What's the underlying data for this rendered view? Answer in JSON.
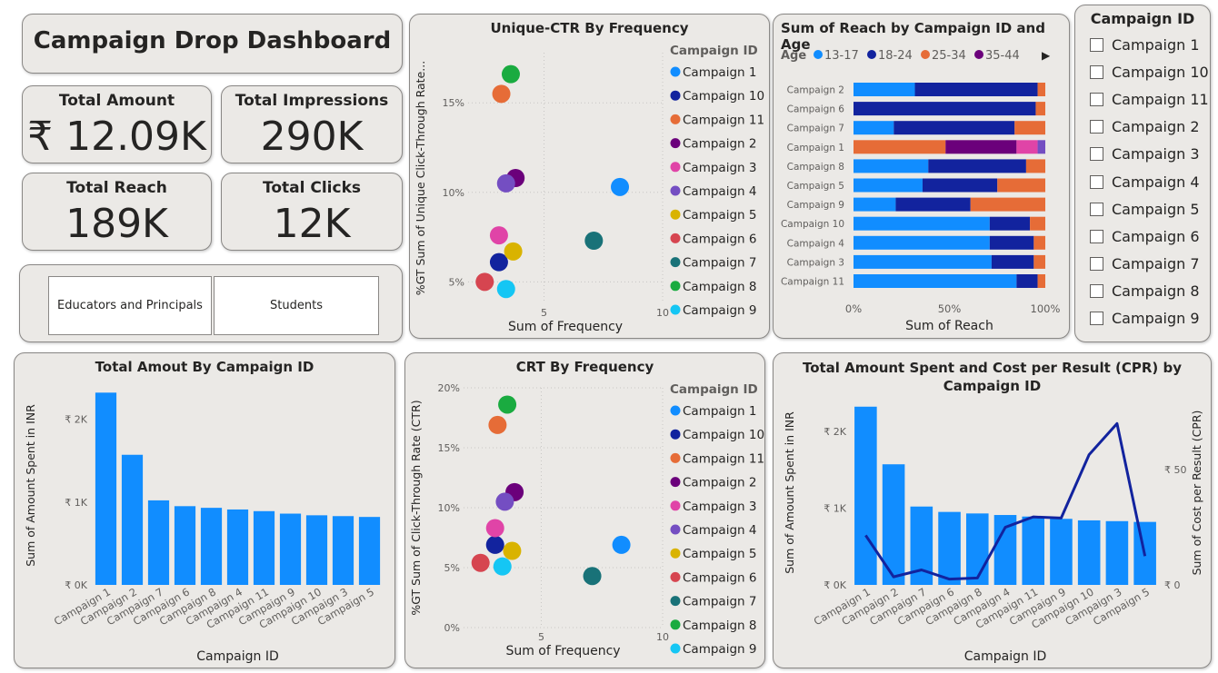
{
  "dashboard_title": "Campaign Drop Dashboard",
  "kpis": [
    {
      "label": "Total Amount",
      "value": "₹ 12.09K"
    },
    {
      "label": "Total Impressions",
      "value": "290K"
    },
    {
      "label": "Total Reach",
      "value": "189K"
    },
    {
      "label": "Total Clicks",
      "value": "12K"
    }
  ],
  "audience_slicer": {
    "options": [
      "Educators and Principals",
      "Students"
    ]
  },
  "campaign_slicer": {
    "title": "Campaign ID",
    "options": [
      "Campaign 1",
      "Campaign 10",
      "Campaign 11",
      "Campaign 2",
      "Campaign 3",
      "Campaign 4",
      "Campaign 5",
      "Campaign 6",
      "Campaign 7",
      "Campaign 8",
      "Campaign 9"
    ]
  },
  "campaign_colors": {
    "Campaign 1": "#118dff",
    "Campaign 10": "#12239e",
    "Campaign 11": "#e66c37",
    "Campaign 2": "#6b007b",
    "Campaign 3": "#e044a7",
    "Campaign 4": "#744ec2",
    "Campaign 5": "#d9b300",
    "Campaign 6": "#d64550",
    "Campaign 7": "#197278",
    "Campaign 8": "#1aab40",
    "Campaign 9": "#15c6f4"
  },
  "chart_data": [
    {
      "id": "unique_ctr",
      "type": "scatter",
      "title": "Unique-CTR By Frequency",
      "xlabel": "Sum of Frequency",
      "ylabel": "%GT Sum of Unique Click-Through Rate...",
      "xlim": [
        1.8,
        10
      ],
      "ylim": [
        3.8,
        17.8
      ],
      "xticks": [
        {
          "v": 5,
          "label": "5"
        },
        {
          "v": 10,
          "label": "10"
        }
      ],
      "yticks": [
        {
          "v": 5,
          "label": "5%"
        },
        {
          "v": 10,
          "label": "10%"
        },
        {
          "v": 15,
          "label": "15%"
        }
      ],
      "legend_title": "Campaign ID",
      "points": [
        {
          "name": "Campaign 1",
          "x": 8.2,
          "y": 10.3
        },
        {
          "name": "Campaign 10",
          "x": 3.1,
          "y": 6.1
        },
        {
          "name": "Campaign 11",
          "x": 3.2,
          "y": 15.5
        },
        {
          "name": "Campaign 2",
          "x": 3.8,
          "y": 10.8
        },
        {
          "name": "Campaign 3",
          "x": 3.1,
          "y": 7.6
        },
        {
          "name": "Campaign 4",
          "x": 3.4,
          "y": 10.5
        },
        {
          "name": "Campaign 5",
          "x": 3.7,
          "y": 6.7
        },
        {
          "name": "Campaign 6",
          "x": 2.5,
          "y": 5.0
        },
        {
          "name": "Campaign 7",
          "x": 7.1,
          "y": 7.3
        },
        {
          "name": "Campaign 8",
          "x": 3.6,
          "y": 16.6
        },
        {
          "name": "Campaign 9",
          "x": 3.4,
          "y": 4.6
        }
      ]
    },
    {
      "id": "reach_age",
      "type": "bar",
      "orientation": "horizontal-100%-stacked",
      "title": "Sum of Reach by Campaign ID and Age",
      "xlabel": "Sum of Reach",
      "legend_title": "Age",
      "legend_more": "▶",
      "xticks": [
        "0%",
        "50%",
        "100%"
      ],
      "categories": [
        "Campaign 2",
        "Campaign 6",
        "Campaign 7",
        "Campaign 1",
        "Campaign 8",
        "Campaign 5",
        "Campaign 9",
        "Campaign 10",
        "Campaign 4",
        "Campaign 3",
        "Campaign 11"
      ],
      "series": [
        {
          "name": "13-17",
          "color": "#118dff",
          "values": [
            32,
            0,
            21,
            0,
            39,
            36,
            22,
            71,
            71,
            72,
            85
          ]
        },
        {
          "name": "18-24",
          "color": "#12239e",
          "values": [
            64,
            95,
            63,
            0,
            51,
            39,
            39,
            21,
            23,
            22,
            11
          ]
        },
        {
          "name": "25-34",
          "color": "#e66c37",
          "values": [
            4,
            5,
            16,
            48,
            10,
            25,
            39,
            8,
            6,
            6,
            4
          ]
        },
        {
          "name": "35-44",
          "color": "#6b007b",
          "values": [
            0,
            0,
            0,
            37,
            0,
            0,
            0,
            0,
            0,
            0,
            0
          ]
        },
        {
          "name": "",
          "color": "#e044a7",
          "values": [
            0,
            0,
            0,
            11,
            0,
            0,
            0,
            0,
            0,
            0,
            0
          ]
        },
        {
          "name": "",
          "color": "#744ec2",
          "values": [
            0,
            0,
            0,
            4,
            0,
            0,
            0,
            0,
            0,
            0,
            0
          ]
        }
      ]
    },
    {
      "id": "amount_by_campaign",
      "type": "bar",
      "title": "Total Amout By Campaign ID",
      "xlabel": "Campaign ID",
      "ylabel": "Sum of Amount Spent in INR",
      "ylim": [
        0,
        2400
      ],
      "yticks": [
        {
          "v": 0,
          "label": "₹ 0K"
        },
        {
          "v": 1000,
          "label": "₹ 1K"
        },
        {
          "v": 2000,
          "label": "₹ 2K"
        }
      ],
      "categories": [
        "Campaign 1",
        "Campaign 2",
        "Campaign 7",
        "Campaign 6",
        "Campaign 8",
        "Campaign 4",
        "Campaign 11",
        "Campaign 9",
        "Campaign 10",
        "Campaign 3",
        "Campaign 5"
      ],
      "values": [
        2320,
        1570,
        1020,
        950,
        930,
        910,
        890,
        860,
        840,
        830,
        820
      ]
    },
    {
      "id": "crt_frequency",
      "type": "scatter",
      "title": "CRT By Frequency",
      "xlabel": "Sum of Frequency",
      "ylabel": "%GT Sum of Click-Through Rate (CTR)",
      "xlim": [
        1.8,
        10
      ],
      "ylim": [
        0,
        20
      ],
      "xticks": [
        {
          "v": 5,
          "label": "5"
        },
        {
          "v": 10,
          "label": "10"
        }
      ],
      "yticks": [
        {
          "v": 0,
          "label": "0%"
        },
        {
          "v": 5,
          "label": "5%"
        },
        {
          "v": 10,
          "label": "10%"
        },
        {
          "v": 15,
          "label": "15%"
        },
        {
          "v": 20,
          "label": "20%"
        }
      ],
      "legend_title": "Campaign ID",
      "points": [
        {
          "name": "Campaign 1",
          "x": 8.3,
          "y": 6.9
        },
        {
          "name": "Campaign 10",
          "x": 3.1,
          "y": 6.9
        },
        {
          "name": "Campaign 11",
          "x": 3.2,
          "y": 16.9
        },
        {
          "name": "Campaign 2",
          "x": 3.9,
          "y": 11.3
        },
        {
          "name": "Campaign 3",
          "x": 3.1,
          "y": 8.3
        },
        {
          "name": "Campaign 4",
          "x": 3.5,
          "y": 10.5
        },
        {
          "name": "Campaign 5",
          "x": 3.8,
          "y": 6.4
        },
        {
          "name": "Campaign 6",
          "x": 2.5,
          "y": 5.4
        },
        {
          "name": "Campaign 7",
          "x": 7.1,
          "y": 4.3
        },
        {
          "name": "Campaign 8",
          "x": 3.6,
          "y": 18.6
        },
        {
          "name": "Campaign 9",
          "x": 3.4,
          "y": 5.1
        }
      ]
    },
    {
      "id": "amount_cpr",
      "type": "bar",
      "combo": "bar+line",
      "title": "Total Amount Spent and Cost per Result (CPR) by Campaign ID",
      "xlabel": "Campaign ID",
      "ylabel": "Sum of Amount Spent in INR",
      "y2label": "Sum of Cost per Result (CPR)",
      "ylim": [
        0,
        2400
      ],
      "y2lim": [
        0,
        80
      ],
      "yticks": [
        {
          "v": 0,
          "label": "₹ 0K"
        },
        {
          "v": 1000,
          "label": "₹ 1K"
        },
        {
          "v": 2000,
          "label": "₹ 2K"
        }
      ],
      "y2ticks": [
        {
          "v": 0,
          "label": "₹ 0"
        },
        {
          "v": 50,
          "label": "₹ 50"
        }
      ],
      "categories": [
        "Campaign 1",
        "Campaign 2",
        "Campaign 7",
        "Campaign 6",
        "Campaign 8",
        "Campaign 4",
        "Campaign 11",
        "Campaign 9",
        "Campaign 10",
        "Campaign 3",
        "Campaign 5"
      ],
      "values": [
        2320,
        1570,
        1020,
        950,
        930,
        910,
        890,
        860,
        840,
        830,
        820
      ],
      "line_values": [
        21.5,
        3.5,
        6.5,
        2.5,
        3.0,
        25.0,
        29.5,
        29.0,
        56.5,
        70.0,
        12.5
      ]
    }
  ]
}
